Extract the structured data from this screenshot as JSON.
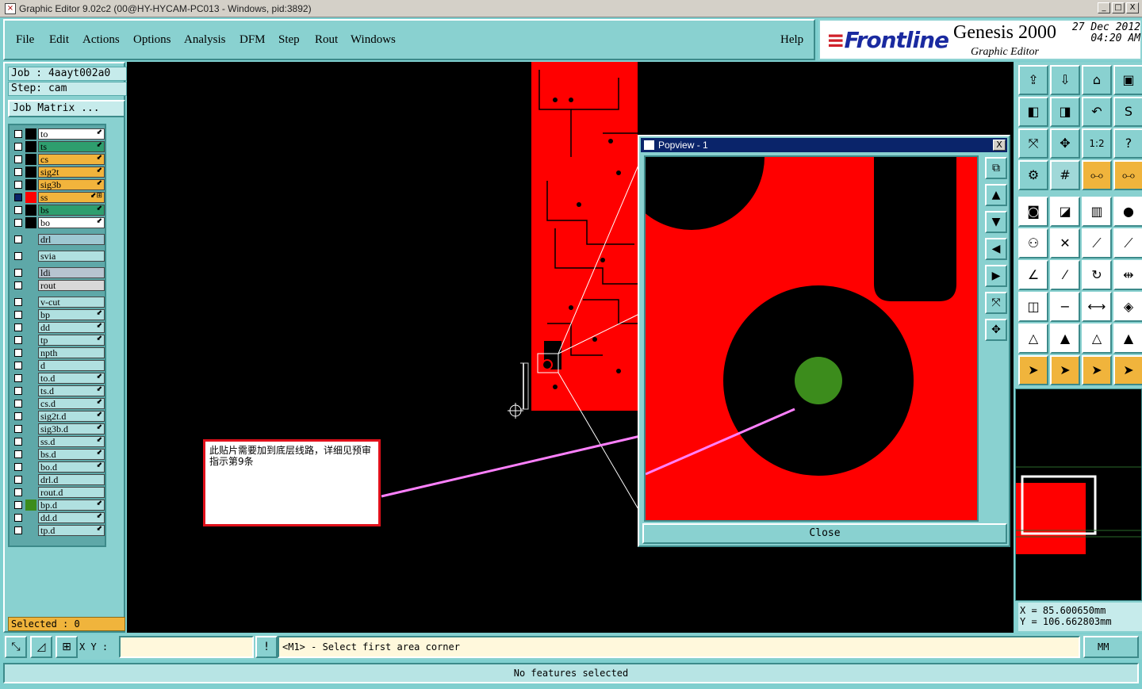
{
  "window": {
    "title": "Graphic Editor 9.02c2 (00@HY-HYCAM-PC013 - Windows, pid:3892)",
    "buttons": [
      "_",
      "□",
      "X"
    ]
  },
  "menu": {
    "file": "File",
    "edit": "Edit",
    "actions": "Actions",
    "options": "Options",
    "analysis": "Analysis",
    "dfm": "DFM",
    "step": "Step",
    "rout": "Rout",
    "windows": "Windows",
    "help": "Help"
  },
  "brand": {
    "logo": "Frontline",
    "product": "Genesis 2000",
    "subtitle": "Graphic Editor",
    "date": "27 Dec 2012",
    "time": "04:20 AM"
  },
  "job": {
    "job_line": "Job : 4aayt002a0",
    "step_line": "Step: cam",
    "matrix_button": "Job Matrix ..."
  },
  "layers": [
    {
      "name": "to",
      "color": "#ffffff",
      "swatch": "#000000",
      "arrow": "⬋"
    },
    {
      "name": "ts",
      "color": "#2e9e6e",
      "swatch": "#000000",
      "arrow": "⬋"
    },
    {
      "name": "cs",
      "color": "#f2b43c",
      "swatch": "#000000",
      "arrow": "⬋"
    },
    {
      "name": "sig2t",
      "color": "#f2b43c",
      "swatch": "#000000",
      "arrow": "⬋"
    },
    {
      "name": "sig3b",
      "color": "#f2b43c",
      "swatch": "#000000",
      "arrow": "⬋"
    },
    {
      "name": "ss",
      "color": "#f2b43c",
      "swatch": "#ff0000",
      "arrow": "⬋⊞",
      "active": true
    },
    {
      "name": "bs",
      "color": "#2e9e6e",
      "swatch": "#000000",
      "arrow": "⬋"
    },
    {
      "name": "bo",
      "color": "#ffffff",
      "swatch": "#000000",
      "arrow": "⬋"
    },
    {
      "name": "drl",
      "color": "#9ec8d2",
      "swatch": "#5ea8a8",
      "arrow": ""
    },
    {
      "name": "svia",
      "color": "#b0e0e0",
      "swatch": "#5ea8a8",
      "arrow": ""
    },
    {
      "name": "ldi",
      "color": "#b7c4d0",
      "swatch": "#5ea8a8",
      "arrow": ""
    },
    {
      "name": "rout",
      "color": "#d8d8d8",
      "swatch": "#5ea8a8",
      "arrow": ""
    },
    {
      "name": "v-cut",
      "color": "#b0e0e0",
      "swatch": "#5ea8a8",
      "arrow": ""
    },
    {
      "name": "bp",
      "color": "#b0e0e0",
      "swatch": "#5ea8a8",
      "arrow": "⬋"
    },
    {
      "name": "dd",
      "color": "#b0e0e0",
      "swatch": "#5ea8a8",
      "arrow": "⬋"
    },
    {
      "name": "tp",
      "color": "#b0e0e0",
      "swatch": "#5ea8a8",
      "arrow": "⬋"
    },
    {
      "name": "npth",
      "color": "#b0e0e0",
      "swatch": "#5ea8a8",
      "arrow": ""
    },
    {
      "name": "d",
      "color": "#b0e0e0",
      "swatch": "#5ea8a8",
      "arrow": ""
    },
    {
      "name": "to.d",
      "color": "#b0e0e0",
      "swatch": "#5ea8a8",
      "arrow": "⬋"
    },
    {
      "name": "ts.d",
      "color": "#b0e0e0",
      "swatch": "#5ea8a8",
      "arrow": "⬋"
    },
    {
      "name": "cs.d",
      "color": "#b0e0e0",
      "swatch": "#5ea8a8",
      "arrow": "⬋"
    },
    {
      "name": "sig2t.d",
      "color": "#b0e0e0",
      "swatch": "#5ea8a8",
      "arrow": "⬋"
    },
    {
      "name": "sig3b.d",
      "color": "#b0e0e0",
      "swatch": "#5ea8a8",
      "arrow": "⬋"
    },
    {
      "name": "ss.d",
      "color": "#b0e0e0",
      "swatch": "#5ea8a8",
      "arrow": "⬋"
    },
    {
      "name": "bs.d",
      "color": "#b0e0e0",
      "swatch": "#5ea8a8",
      "arrow": "⬋"
    },
    {
      "name": "bo.d",
      "color": "#b0e0e0",
      "swatch": "#5ea8a8",
      "arrow": "⬋"
    },
    {
      "name": "drl.d",
      "color": "#b0e0e0",
      "swatch": "#5ea8a8",
      "arrow": ""
    },
    {
      "name": "rout.d",
      "color": "#b0e0e0",
      "swatch": "#5ea8a8",
      "arrow": ""
    },
    {
      "name": "bp.d",
      "color": "#b0e0e0",
      "swatch": "#3c8c1c",
      "arrow": "⬋"
    },
    {
      "name": "dd.d",
      "color": "#b0e0e0",
      "swatch": "#5ea8a8",
      "arrow": "⬋"
    },
    {
      "name": "tp.d",
      "color": "#b0e0e0",
      "swatch": "#5ea8a8",
      "arrow": "⬋"
    }
  ],
  "selected": "Selected : 0",
  "callout": {
    "text": "此贴片需要加到底层线路，详细见预审指示第9条"
  },
  "popview": {
    "title": "Popview - 1",
    "close": "Close",
    "close_x": "X"
  },
  "coords": {
    "x": "X  = 85.600650mm",
    "y": "Y  = 106.662803mm"
  },
  "status": {
    "xy_label": "X Y :",
    "xy_value": "",
    "prompt": "<M1> - Select first area corner",
    "units": "MM",
    "message": "No features selected"
  },
  "colors": {
    "panel": "#89d1d0",
    "copper": "#ff0000",
    "drill": "#3c8c1c",
    "arrow": "#ff80ff"
  }
}
